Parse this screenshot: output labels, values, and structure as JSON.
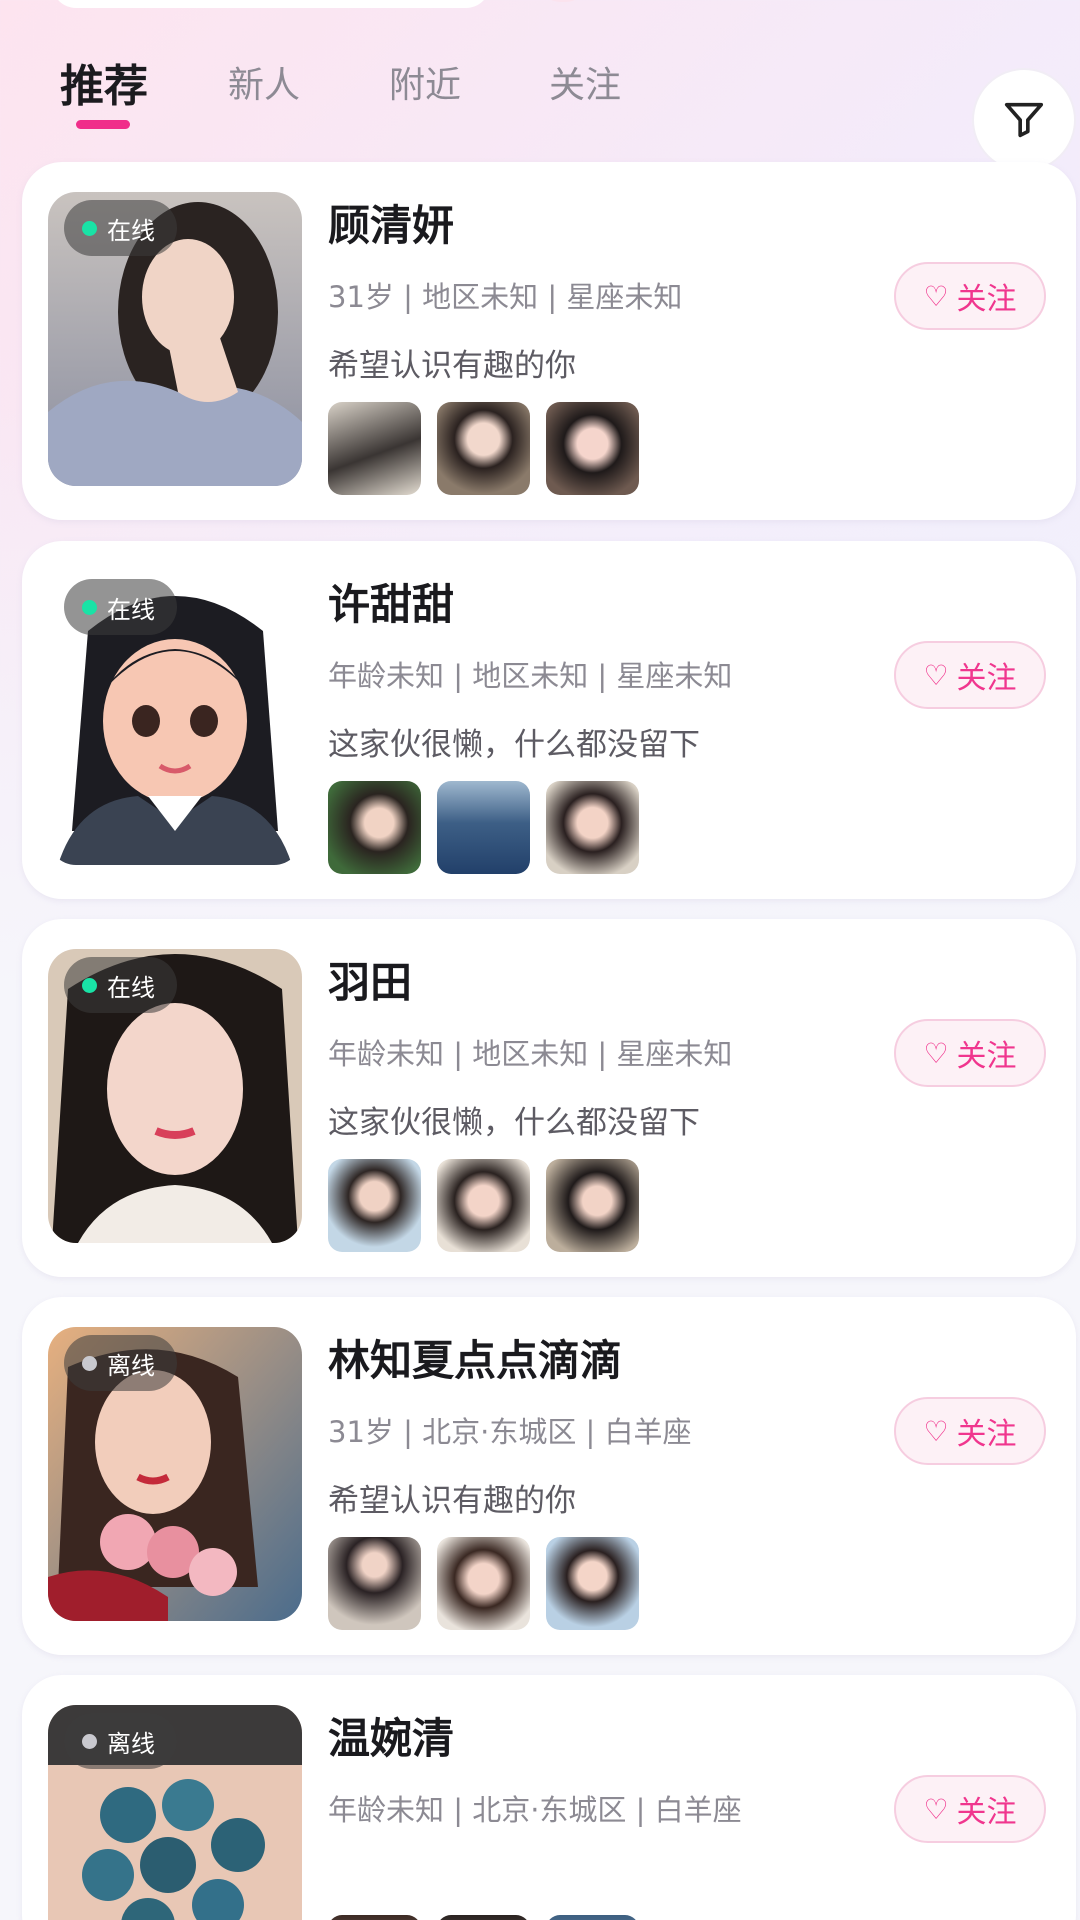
{
  "tabs": [
    {
      "label": "推荐",
      "active": true
    },
    {
      "label": "新人",
      "active": false
    },
    {
      "label": "附近",
      "active": false
    },
    {
      "label": "关注",
      "active": false
    }
  ],
  "filter_icon": "funnel-icon",
  "follow_label": "关注",
  "colors": {
    "accent": "#f02d8a",
    "online": "#19e3a6",
    "offline": "#c9c9cf"
  },
  "users": [
    {
      "name": "顾清妍",
      "status": "在线",
      "info": "31岁 | 地区未知 | 星座未知",
      "bio": "希望认识有趣的你"
    },
    {
      "name": "许甜甜",
      "status": "在线",
      "info": "年龄未知 | 地区未知 | 星座未知",
      "bio": "这家伙很懒，什么都没留下"
    },
    {
      "name": "羽田",
      "status": "在线",
      "info": "年龄未知 | 地区未知 | 星座未知",
      "bio": "这家伙很懒，什么都没留下"
    },
    {
      "name": "林知夏点点滴滴",
      "status": "离线",
      "info": "31岁 | 北京·东城区 | 白羊座",
      "bio": "希望认识有趣的你"
    },
    {
      "name": "温婉清",
      "status": "离线",
      "info": "年龄未知 | 北京·东城区 | 白羊座",
      "bio": ""
    }
  ]
}
